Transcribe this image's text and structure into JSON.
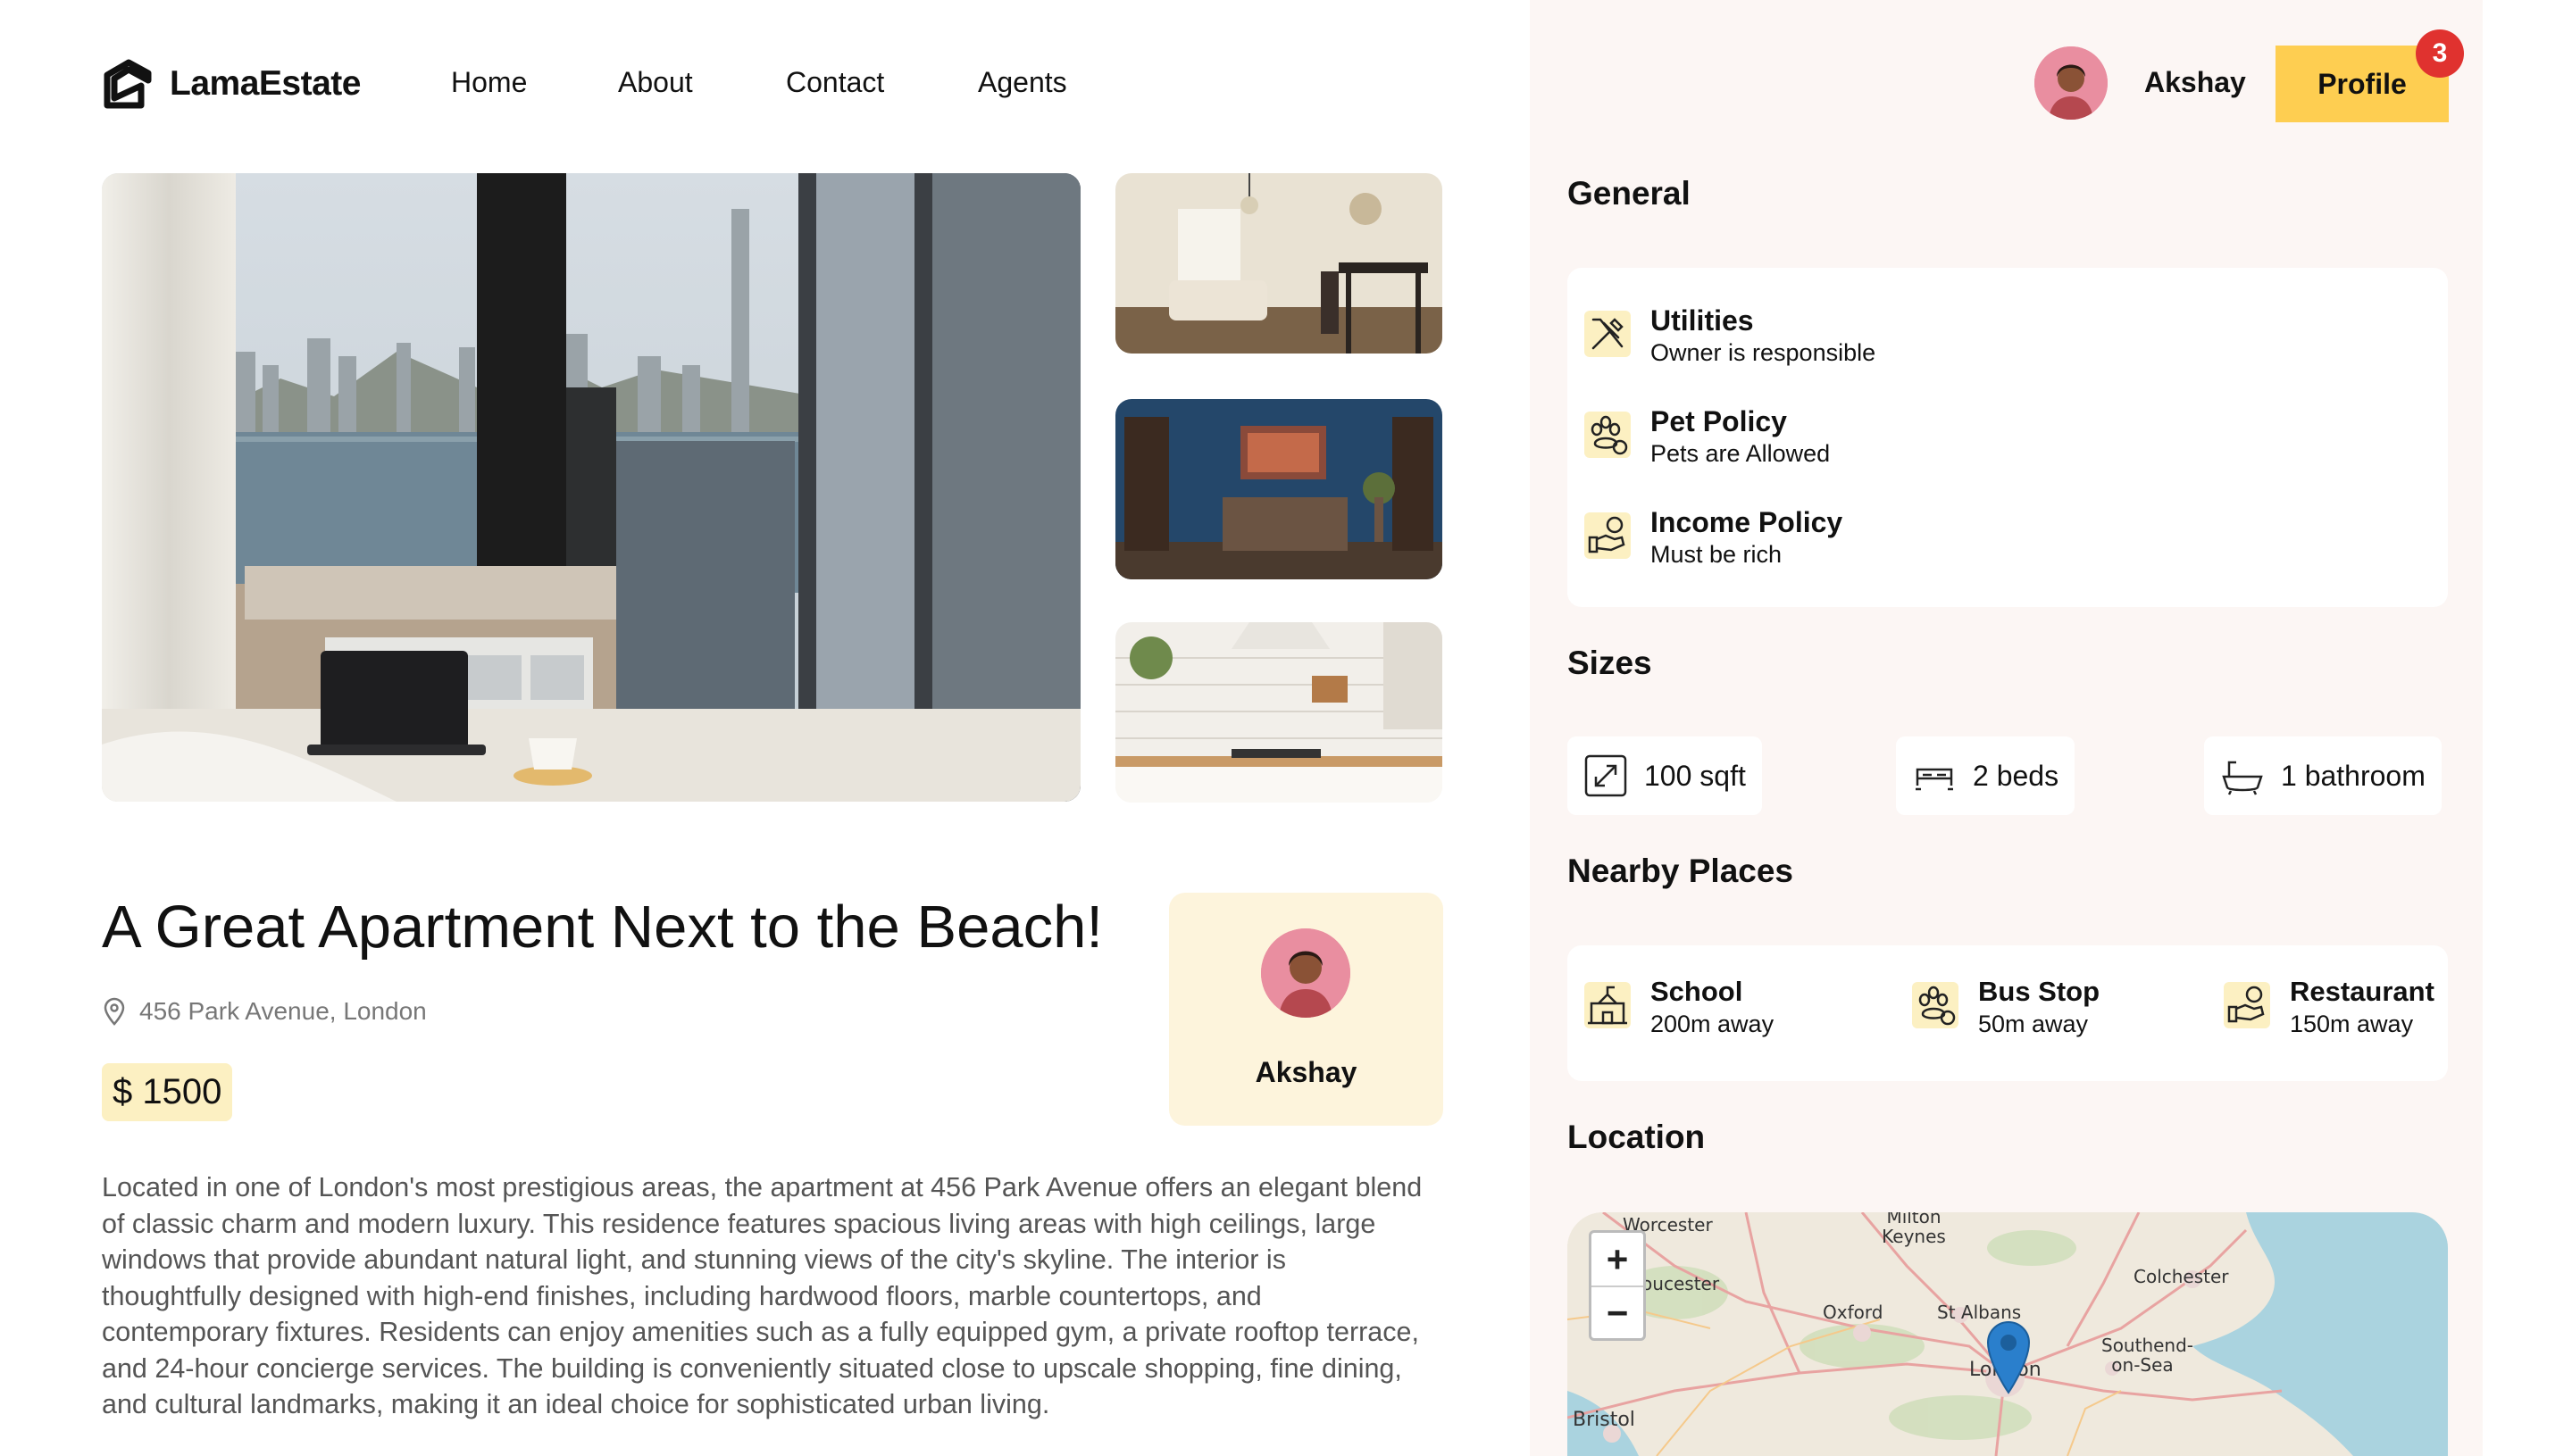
{
  "brand": {
    "name": "LamaEstate"
  },
  "nav": {
    "links": [
      "Home",
      "About",
      "Contact",
      "Agents"
    ],
    "user_name": "Akshay",
    "profile_label": "Profile",
    "notification_count": "3"
  },
  "property": {
    "title": "A Great Apartment Next to the Beach!",
    "address": "456 Park Avenue, London",
    "price": "$ 1500",
    "owner_name": "Akshay",
    "description": "Located in one of London's most prestigious areas, the apartment at 456 Park Avenue offers an elegant blend of classic charm and modern luxury. This residence features spacious living areas with high ceilings, large windows that provide abundant natural light, and stunning views of the city's skyline. The interior is thoughtfully designed with high-end finishes, including hardwood floors, marble countertops, and contemporary fixtures. Residents can enjoy amenities such as a fully equipped gym, a private rooftop terrace, and 24-hour concierge services. The building is conveniently situated close to upscale shopping, fine dining, and cultural landmarks, making it an ideal choice for sophisticated urban living."
  },
  "general": {
    "title": "General",
    "items": [
      {
        "icon": "utility-icon",
        "title": "Utilities",
        "sub": "Owner is responsible"
      },
      {
        "icon": "pet-icon",
        "title": "Pet Policy",
        "sub": "Pets are Allowed"
      },
      {
        "icon": "fee-icon",
        "title": "Income Policy",
        "sub": "Must be rich"
      }
    ]
  },
  "sizes": {
    "title": "Sizes",
    "items": [
      {
        "icon": "size-icon",
        "label": "100 sqft"
      },
      {
        "icon": "bed-icon",
        "label": "2 beds"
      },
      {
        "icon": "bath-icon",
        "label": "1 bathroom"
      }
    ]
  },
  "nearby": {
    "title": "Nearby Places",
    "items": [
      {
        "icon": "school-icon",
        "title": "School",
        "sub": "200m away"
      },
      {
        "icon": "pet-icon",
        "title": "Bus Stop",
        "sub": "50m away"
      },
      {
        "icon": "fee-icon",
        "title": "Restaurant",
        "sub": "150m away"
      }
    ]
  },
  "location": {
    "title": "Location",
    "zoom_in": "+",
    "zoom_out": "−",
    "places": [
      "Worcester",
      "Milton Keynes",
      "Colchester",
      "Gloucester",
      "Oxford",
      "St Albans",
      "London",
      "Southend-on-Sea",
      "Bristol"
    ]
  },
  "colors": {
    "accent": "#fece51",
    "panel_bg": "#fcf6f4",
    "price_bg": "#fcf0c2",
    "badge": "#e0322f"
  }
}
